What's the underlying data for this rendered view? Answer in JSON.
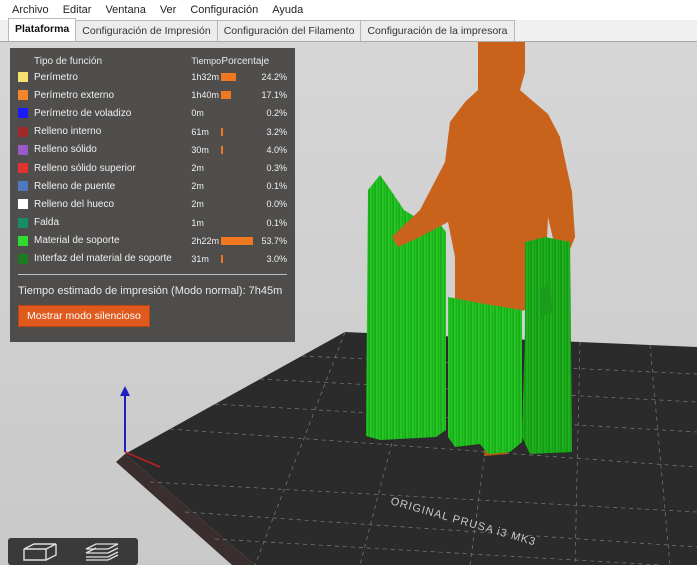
{
  "menu": [
    "Archivo",
    "Editar",
    "Ventana",
    "Ver",
    "Configuración",
    "Ayuda"
  ],
  "tabs": [
    {
      "label": "Plataforma",
      "active": true
    },
    {
      "label": "Configuración de Impresión",
      "active": false
    },
    {
      "label": "Configuración del Filamento",
      "active": false
    },
    {
      "label": "Configuración de la impresora",
      "active": false
    }
  ],
  "legend": {
    "headers": {
      "type": "Tipo de función",
      "length": "Tiempo",
      "percent": "Porcentaje"
    },
    "rows": [
      {
        "color": "#f5e070",
        "name": "Perímetro",
        "length": "1h32m",
        "percent_value": 24.2,
        "percent": "24.2%"
      },
      {
        "color": "#f5862b",
        "name": "Perímetro externo",
        "length": "1h40m",
        "percent_value": 17.1,
        "percent": "17.1%"
      },
      {
        "color": "#1a1aff",
        "name": "Perímetro de voladizo",
        "length": "0m",
        "percent_value": 0.2,
        "percent": "0.2%"
      },
      {
        "color": "#a02828",
        "name": "Relleno interno",
        "length": "61m",
        "percent_value": 3.2,
        "percent": "3.2%"
      },
      {
        "color": "#9b59c8",
        "name": "Relleno sólido",
        "length": "30m",
        "percent_value": 4.0,
        "percent": "4.0%"
      },
      {
        "color": "#e53030",
        "name": "Relleno sólido superior",
        "length": "2m",
        "percent_value": 0.3,
        "percent": "0.3%"
      },
      {
        "color": "#5078c0",
        "name": "Relleno de puente",
        "length": "2m",
        "percent_value": 0.1,
        "percent": "0.1%"
      },
      {
        "color": "#ffffff",
        "name": "Relleno del hueco",
        "length": "2m",
        "percent_value": 0.0,
        "percent": "0.0%"
      },
      {
        "color": "#168c68",
        "name": "Falda",
        "length": "1m",
        "percent_value": 0.1,
        "percent": "0.1%"
      },
      {
        "color": "#2fdc2f",
        "name": "Material de soporte",
        "length": "2h22m",
        "percent_value": 53.7,
        "percent": "53.7%"
      },
      {
        "color": "#1e7a1e",
        "name": "Interfaz del material de soporte",
        "length": "31m",
        "percent_value": 3.0,
        "percent": "3.0%"
      }
    ],
    "estimate_text": "Tiempo estimado de impresión (Modo normal):  7h45m",
    "show_button": "Mostrar modo silencioso"
  },
  "bed_label": "ORIGINAL PRUSA i3 MK3",
  "colors": {
    "model": "#c8621c",
    "support": "#22cc22",
    "bed": "#2a2a2a",
    "grid": "#7a7a7a",
    "axis": "#2020c0"
  },
  "bottom_icons": [
    "object-view-icon",
    "layers-view-icon"
  ]
}
